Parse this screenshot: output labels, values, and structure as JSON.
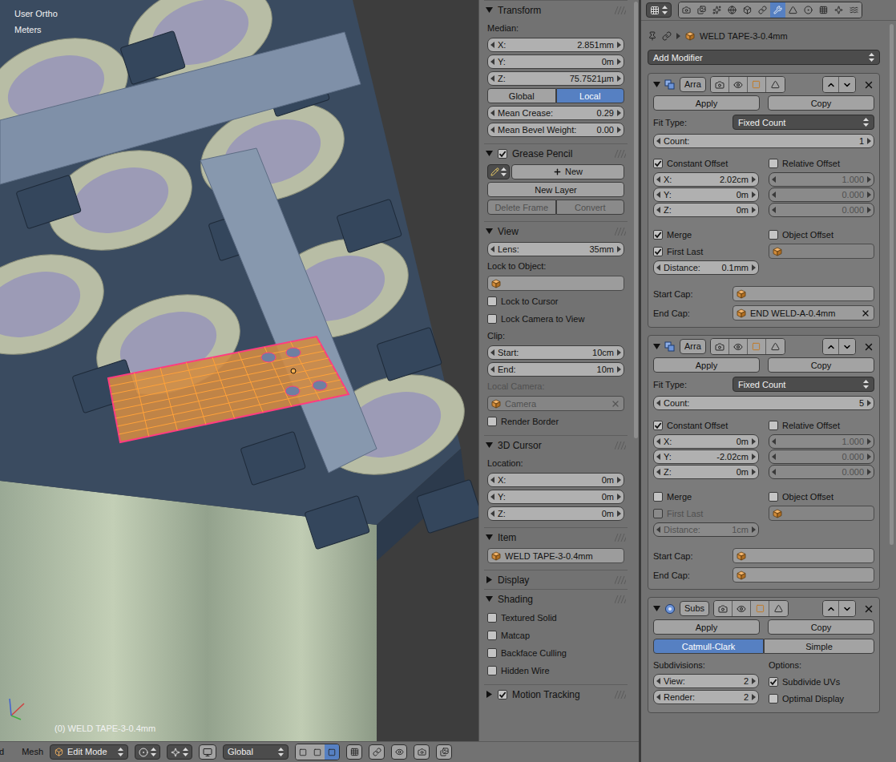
{
  "viewport": {
    "view_name": "User Ortho",
    "units": "Meters",
    "object_label": "(0) WELD TAPE-3-0.4mm"
  },
  "header": {
    "cut_menu": "d",
    "menu": "Mesh",
    "mode": "Edit Mode",
    "orientation": "Global"
  },
  "sidebar": {
    "sections": [
      {
        "title": "Transform",
        "kind": "plain",
        "checked": false,
        "expanded": true,
        "rows": [
          {
            "kind": "label",
            "text": "Median:",
            "disabled": false
          },
          {
            "kind": "number",
            "label": "X:",
            "value": "2.851mm",
            "disabled": false
          },
          {
            "kind": "number",
            "label": "Y:",
            "value": "0m",
            "disabled": false
          },
          {
            "kind": "number",
            "label": "Z:",
            "value": "75.7521µm",
            "disabled": false
          },
          {
            "kind": "segmented",
            "options": [
              {
                "label": "Global",
                "selected": false
              },
              {
                "label": "Local",
                "selected": true
              }
            ]
          },
          {
            "kind": "number",
            "label": "Mean Crease:",
            "value": "0.29",
            "disabled": false
          },
          {
            "kind": "number",
            "label": "Mean Bevel Weight:",
            "value": "0.00",
            "disabled": false
          }
        ]
      },
      {
        "title": "Grease Pencil",
        "kind": "checkbox",
        "checked": true,
        "expanded": true,
        "rows": [
          {
            "kind": "new",
            "label": "New"
          },
          {
            "kind": "button",
            "label": "New Layer",
            "disabled": false
          },
          {
            "kind": "buttons",
            "items": [
              {
                "label": "Delete Frame",
                "disabled": true
              },
              {
                "label": "Convert",
                "disabled": true
              }
            ]
          }
        ]
      },
      {
        "title": "View",
        "kind": "plain",
        "checked": false,
        "expanded": true,
        "rows": [
          {
            "kind": "number",
            "label": "Lens:",
            "value": "35mm",
            "disabled": false
          },
          {
            "kind": "label",
            "text": "Lock to Object:",
            "disabled": false
          },
          {
            "kind": "field",
            "value": "",
            "disabled": false,
            "clear": false
          },
          {
            "kind": "checkbox",
            "label": "Lock to Cursor",
            "checked": false,
            "disabled": false
          },
          {
            "kind": "checkbox",
            "label": "Lock Camera to View",
            "checked": false,
            "disabled": false
          },
          {
            "kind": "label",
            "text": "Clip:",
            "disabled": false
          },
          {
            "kind": "number",
            "label": "Start:",
            "value": "10cm",
            "disabled": false
          },
          {
            "kind": "number",
            "label": "End:",
            "value": "10m",
            "disabled": false
          },
          {
            "kind": "label",
            "text": "Local Camera:",
            "disabled": true
          },
          {
            "kind": "field",
            "value": "Camera",
            "disabled": true,
            "clear": true
          },
          {
            "kind": "checkbox",
            "label": "Render Border",
            "checked": false,
            "disabled": false
          }
        ]
      },
      {
        "title": "3D Cursor",
        "kind": "plain",
        "checked": false,
        "expanded": true,
        "rows": [
          {
            "kind": "label",
            "text": "Location:",
            "disabled": false
          },
          {
            "kind": "number",
            "label": "X:",
            "value": "0m",
            "disabled": false
          },
          {
            "kind": "number",
            "label": "Y:",
            "value": "0m",
            "disabled": false
          },
          {
            "kind": "number",
            "label": "Z:",
            "value": "0m",
            "disabled": false
          }
        ]
      },
      {
        "title": "Item",
        "kind": "plain",
        "checked": false,
        "expanded": true,
        "rows": [
          {
            "kind": "field",
            "value": "WELD TAPE-3-0.4mm",
            "disabled": false,
            "clear": false
          }
        ]
      },
      {
        "title": "Display",
        "kind": "plain",
        "checked": false,
        "expanded": false,
        "rows": []
      },
      {
        "title": "Shading",
        "kind": "plain",
        "checked": false,
        "expanded": true,
        "rows": [
          {
            "kind": "checkbox",
            "label": "Textured Solid",
            "checked": false,
            "disabled": false
          },
          {
            "kind": "checkbox",
            "label": "Matcap",
            "checked": false,
            "disabled": false
          },
          {
            "kind": "checkbox",
            "label": "Backface Culling",
            "checked": false,
            "disabled": false
          },
          {
            "kind": "checkbox",
            "label": "Hidden Wire",
            "checked": false,
            "disabled": false
          }
        ]
      },
      {
        "title": "Motion Tracking",
        "kind": "checkbox",
        "checked": true,
        "expanded": false,
        "rows": []
      }
    ]
  },
  "properties": {
    "context_tabs": [
      {
        "selected": false
      },
      {
        "selected": false
      },
      {
        "selected": false
      },
      {
        "selected": false
      },
      {
        "selected": false
      },
      {
        "selected": false
      },
      {
        "selected": true
      },
      {
        "selected": false
      },
      {
        "selected": false
      },
      {
        "selected": false
      },
      {
        "selected": false
      },
      {
        "selected": false
      }
    ],
    "breadcrumb": "WELD TAPE-3-0.4mm",
    "add_modifier": "Add Modifier",
    "modifiers": [
      {
        "kind": "array",
        "name": "Arra",
        "expanded": true,
        "apply": "Apply",
        "copy": "Copy",
        "fit_type": {
          "label": "Fit Type:",
          "value": "Fixed Count"
        },
        "count": {
          "label": "Count:",
          "value": "1"
        },
        "constant_offset": {
          "label": "Constant Offset",
          "checked": true,
          "values": [
            {
              "label": "X:",
              "value": "2.02cm"
            },
            {
              "label": "Y:",
              "value": "0m"
            },
            {
              "label": "Z:",
              "value": "0m"
            }
          ]
        },
        "relative_offset": {
          "label": "Relative Offset",
          "checked": false,
          "values": [
            "1.000",
            "0.000",
            "0.000"
          ]
        },
        "merge": {
          "label": "Merge",
          "checked": true
        },
        "object_offset": {
          "label": "Object Offset",
          "checked": false,
          "value": ""
        },
        "first_last": {
          "label": "First Last",
          "checked": true,
          "disabled": false
        },
        "distance": {
          "label": "Distance:",
          "value": "0.1mm",
          "disabled": false
        },
        "start_cap": {
          "label": "Start Cap:",
          "value": "",
          "clear": false
        },
        "end_cap": {
          "label": "End Cap:",
          "value": "END WELD-A-0.4mm",
          "clear": true
        }
      },
      {
        "kind": "array",
        "name": "Arra",
        "expanded": true,
        "apply": "Apply",
        "copy": "Copy",
        "fit_type": {
          "label": "Fit Type:",
          "value": "Fixed Count"
        },
        "count": {
          "label": "Count:",
          "value": "5"
        },
        "constant_offset": {
          "label": "Constant Offset",
          "checked": true,
          "values": [
            {
              "label": "X:",
              "value": "0m"
            },
            {
              "label": "Y:",
              "value": "-2.02cm"
            },
            {
              "label": "Z:",
              "value": "0m"
            }
          ]
        },
        "relative_offset": {
          "label": "Relative Offset",
          "checked": false,
          "values": [
            "1.000",
            "0.000",
            "0.000"
          ]
        },
        "merge": {
          "label": "Merge",
          "checked": false
        },
        "object_offset": {
          "label": "Object Offset",
          "checked": false,
          "value": ""
        },
        "first_last": {
          "label": "First Last",
          "checked": false,
          "disabled": true
        },
        "distance": {
          "label": "Distance:",
          "value": "1cm",
          "disabled": true
        },
        "start_cap": {
          "label": "Start Cap:",
          "value": "",
          "clear": false
        },
        "end_cap": {
          "label": "End Cap:",
          "value": "",
          "clear": false
        }
      },
      {
        "kind": "subsurf",
        "name": "Subs",
        "expanded": true,
        "apply": "Apply",
        "copy": "Copy",
        "types": [
          {
            "label": "Catmull-Clark",
            "selected": true
          },
          {
            "label": "Simple",
            "selected": false
          }
        ],
        "subdivisions_label": "Subdivisions:",
        "options_label": "Options:",
        "levels": [
          {
            "label": "View:",
            "value": "2"
          },
          {
            "label": "Render:",
            "value": "2"
          }
        ],
        "options": [
          {
            "label": "Subdivide UVs",
            "checked": true
          },
          {
            "label": "Optimal Display",
            "checked": false
          }
        ]
      }
    ]
  }
}
